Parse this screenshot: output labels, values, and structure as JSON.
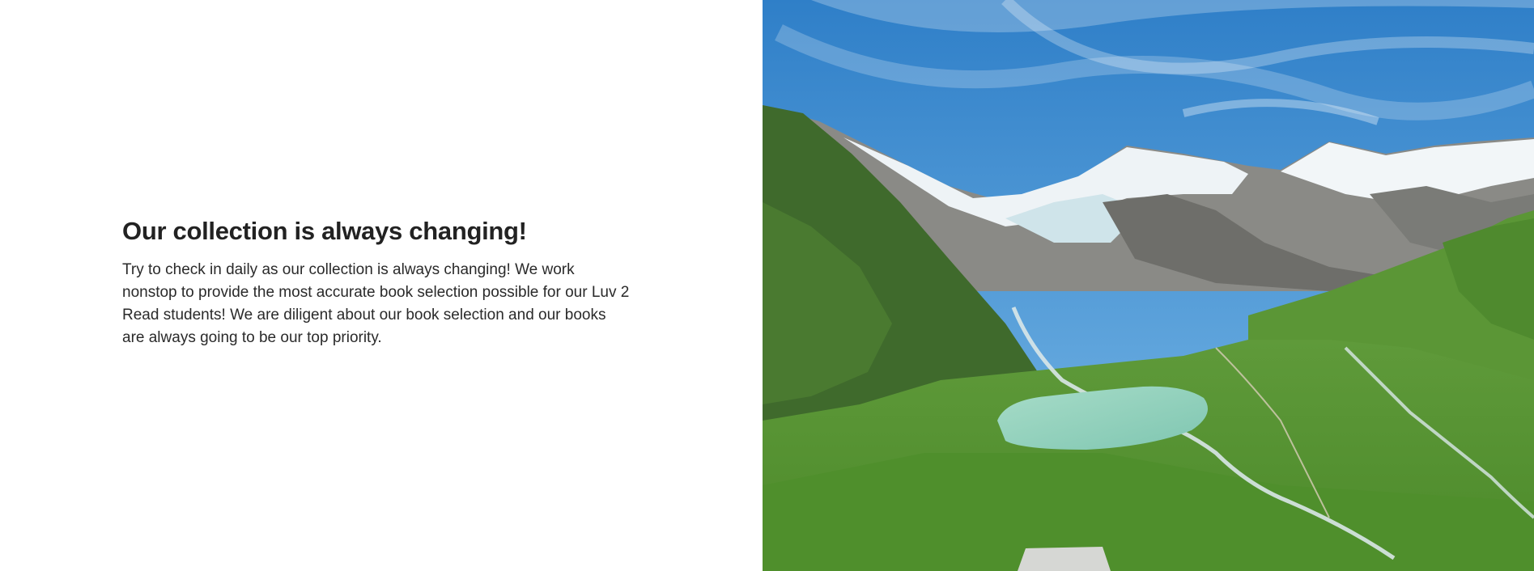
{
  "section": {
    "heading": "Our collection is always changing!",
    "body": "Try to check in daily as our collection is always changing! We work nonstop to provide the most accurate book selection possible for our Luv 2 Read students! We are diligent about our book selection and our books are always going to be our top priority."
  },
  "image": {
    "subject": "mountain-landscape-glacier-lake",
    "colors": {
      "sky_top": "#2f7fc8",
      "sky_bottom": "#6fb3e6",
      "snow": "#f2f6f8",
      "rock": "#6e6e6a",
      "grass": "#5f9a3a",
      "lake": "#8fd1bc"
    }
  }
}
